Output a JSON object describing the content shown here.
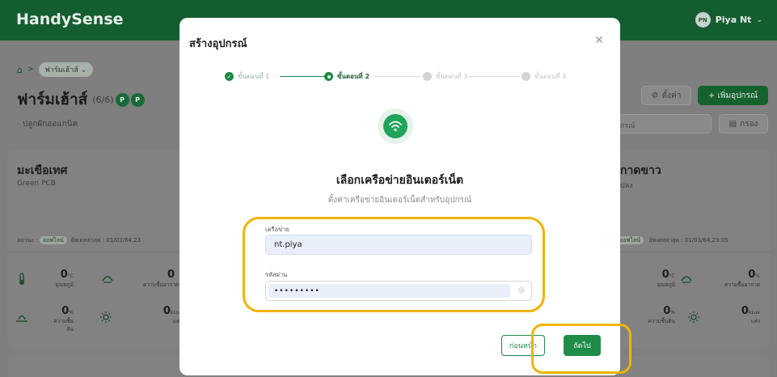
{
  "app": {
    "brand": "HandySense",
    "user_initials": "PN",
    "user_name": "Piya Nt"
  },
  "breadcrumb": {
    "home_icon": "home-icon",
    "current": "ฟาร์มเฮ้าส์"
  },
  "farm": {
    "title": "ฟาร์มเฮ้าส์",
    "count": "(6/6)",
    "member_badges": [
      "P",
      "P"
    ],
    "subtitle": "- ปลูกผักออแกนิค"
  },
  "toolbar": {
    "settings_label": "ตั้งค่า",
    "add_label": "+ เพิ่มอุปกรณ์",
    "search_placeholder": "กรณ์",
    "filter_label": "กรอง"
  },
  "devices": [
    {
      "name": "มะเขือเทศ",
      "type": "Green PCB",
      "status_label": "สถานะ :",
      "status": "ออฟไลน์",
      "updated": "อัพเดทล่าสุด : 01/03/64,23",
      "sensors": [
        {
          "value": "0",
          "unit": "°C",
          "label": "อุณหภูมิ",
          "icon": "thermometer-icon"
        },
        {
          "value": "0",
          "unit": "",
          "label": "ความชื้นอากาศ",
          "icon": "humidity-icon"
        },
        {
          "value": "0",
          "unit": "%",
          "label": "ความชื้นดิน",
          "icon": "soil-icon"
        },
        {
          "value": "0",
          "unit": "kLux",
          "label": "แสง",
          "icon": "sun-icon"
        }
      ]
    },
    {
      "name": "กาดขาว",
      "type": "ปลง",
      "status": "ออฟไลน์",
      "updated": "อัพเดทล่าสุด : 01/03/64,23:05",
      "sensors": [
        {
          "value": "0",
          "unit": "°C",
          "label": "อุณหภูมิ",
          "icon": "thermometer-icon"
        },
        {
          "value": "0",
          "unit": "%",
          "label": "ความชื้นอากาศ",
          "icon": "humidity-icon"
        },
        {
          "value": "0",
          "unit": "%",
          "label": "ความชื้นดิน",
          "icon": "soil-icon"
        },
        {
          "value": "0",
          "unit": "kLux",
          "label": "แสง",
          "icon": "sun-icon"
        }
      ]
    }
  ],
  "modal": {
    "title": "สร้างอุปกรณ์",
    "steps": [
      {
        "label": "ขั้นตอนที่ 1",
        "state": "done"
      },
      {
        "label": "ขั้นตอนที่ 2",
        "state": "current"
      },
      {
        "label": "ขั้นตอนที่ 3",
        "state": "todo"
      },
      {
        "label": "ขั้นตอนที่ 4",
        "state": "todo"
      }
    ],
    "icon": "wifi-icon",
    "heading": "เลือกเครือข่ายอินเตอร์เน็ต",
    "description": "ตั้งค่าเครือข่ายอินเตอร์เน็ตสำหรับอุปกรณ์",
    "network_label": "เครือข่าย",
    "network_value": "nt.piya",
    "password_label": "รหัสผ่าน",
    "password_value": "•••••••••",
    "back_label": "ก่อนหน้า",
    "next_label": "ถัดไป"
  },
  "colors": {
    "brand": "#1f8d47",
    "highlight": "#f0b400"
  }
}
